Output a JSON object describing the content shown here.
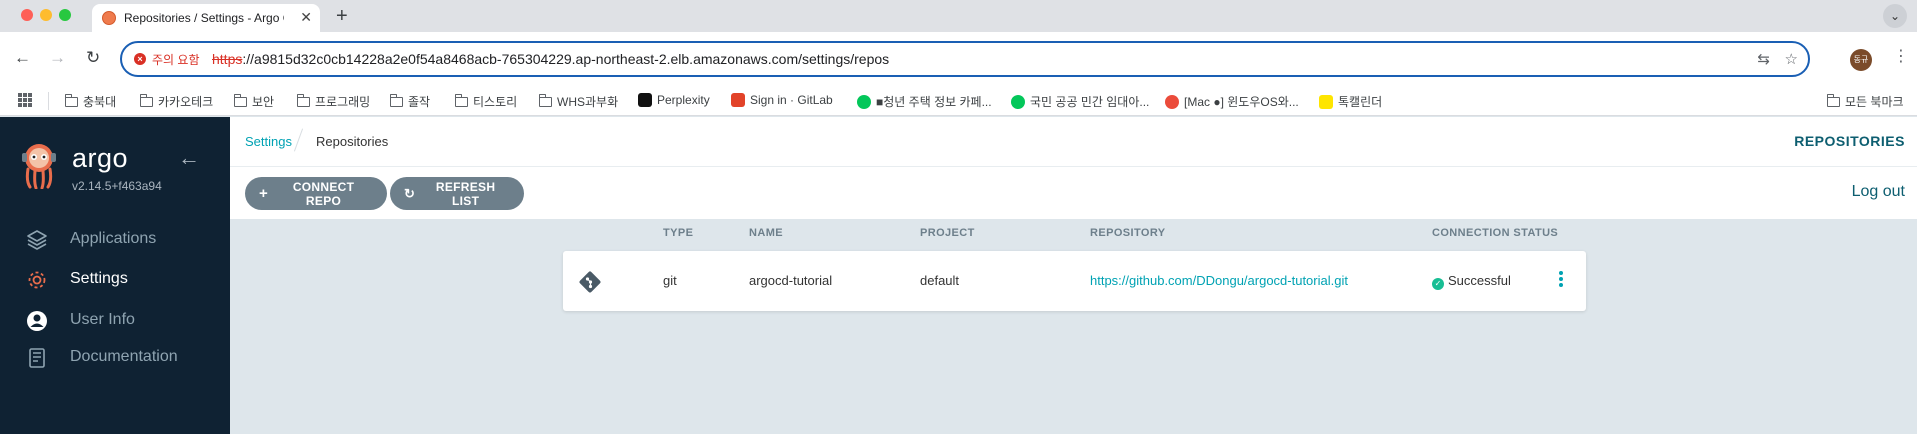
{
  "browser": {
    "tab_title": "Repositories / Settings - Argo CD",
    "tab_close": "✕",
    "new_tab": "+",
    "security_warning": "주의 요함",
    "url_scheme": "https",
    "url_rest": "://a9815d32c0cb14228a2e0f54a8468acb-765304229.ap-northeast-2.elb.amazonaws.com/settings/repos",
    "profile_label": "동규",
    "bookmarks": [
      {
        "label": "충북대",
        "icon": "folder-icon"
      },
      {
        "label": "카카오테크",
        "icon": "folder-icon"
      },
      {
        "label": "보안",
        "icon": "folder-icon"
      },
      {
        "label": "프로그래밍",
        "icon": "folder-icon"
      },
      {
        "label": "졸작",
        "icon": "folder-icon"
      },
      {
        "label": "티스토리",
        "icon": "folder-icon"
      },
      {
        "label": "WHS과부화",
        "icon": "folder-icon"
      },
      {
        "label": "Perplexity",
        "icon": "perplexity-icon"
      },
      {
        "label": "Sign in · GitLab",
        "icon": "gitlab-icon"
      },
      {
        "label": "■청년 주택 정보 카페...",
        "icon": "naver-cafe-icon"
      },
      {
        "label": "국민 공공 민간 임대아...",
        "icon": "naver-cafe-icon"
      },
      {
        "label": "[Mac ●] 윈도우OS와...",
        "icon": "tistory-icon"
      },
      {
        "label": "톡캘린더",
        "icon": "calendar-icon"
      }
    ],
    "all_bookmarks": "모든 북마크"
  },
  "sidebar": {
    "brand": "argo",
    "version": "v2.14.5+f463a94",
    "items": [
      {
        "label": "Applications",
        "icon": "layers-icon"
      },
      {
        "label": "Settings",
        "icon": "gear-icon"
      },
      {
        "label": "User Info",
        "icon": "user-icon"
      },
      {
        "label": "Documentation",
        "icon": "book-icon"
      }
    ]
  },
  "header": {
    "breadcrumb_root": "Settings",
    "breadcrumb_current": "Repositories",
    "page_title": "REPOSITORIES"
  },
  "toolbar": {
    "connect_label": "CONNECT REPO",
    "refresh_label": "REFRESH LIST",
    "logout_label": "Log out"
  },
  "table": {
    "columns": [
      "TYPE",
      "NAME",
      "PROJECT",
      "REPOSITORY",
      "CONNECTION STATUS"
    ],
    "rows": [
      {
        "type": "git",
        "name": "argocd-tutorial",
        "project": "default",
        "repository": "https://github.com/DDongu/argocd-tutorial.git",
        "status": "Successful"
      }
    ]
  },
  "colors": {
    "sidebar_bg": "#0f2233",
    "accent": "#00a2b3",
    "button": "#6d7f8b",
    "success": "#18be94"
  }
}
